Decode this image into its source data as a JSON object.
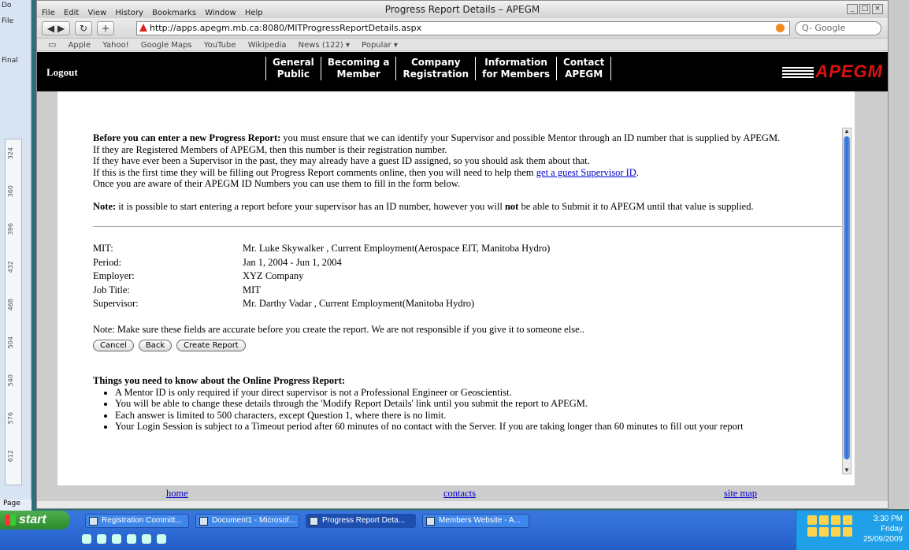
{
  "word": {
    "toolbar_items": [
      "Do",
      "File",
      "Final",
      "Page"
    ],
    "ruler_marks": [
      "324",
      "360",
      "396",
      "432",
      "468",
      "504",
      "540",
      "576",
      "612"
    ]
  },
  "browser": {
    "title": "Progress Report Details – APEGM",
    "menu": [
      "File",
      "Edit",
      "View",
      "History",
      "Bookmarks",
      "Window",
      "Help"
    ],
    "url": "http://apps.apegm.mb.ca:8080/MITProgressReportDetails.aspx",
    "search_placeholder": "Q- Google",
    "bookmarks": [
      "Apple",
      "Yahoo!",
      "Google Maps",
      "YouTube",
      "Wikipedia",
      "News (122) ▾",
      "Popular ▾"
    ]
  },
  "site": {
    "logout": "Logout",
    "nav": [
      {
        "line1": "General",
        "line2": "Public"
      },
      {
        "line1": "Becoming a",
        "line2": "Member"
      },
      {
        "line1": "Company",
        "line2": "Registration"
      },
      {
        "line1": "Information",
        "line2": "for Members"
      },
      {
        "line1": "Contact",
        "line2": "APEGM"
      }
    ],
    "logo": "APEGM"
  },
  "intro": {
    "lead_bold": "Before you can enter a new Progress Report:",
    "lead_rest": " you must ensure that we can identify your Supervisor and possible Mentor through an ID number that is supplied by APEGM.",
    "line2": "If they are Registered Members of APEGM, then this number is their registration number.",
    "line3": "If they have ever been a Supervisor in the past, they may already have a guest ID assigned, so you should ask them about that.",
    "line4_pre": "If this is the first time they will be filling out Progress Report comments online, then you will need to help them ",
    "line4_link": "get a guest Supervisor ID",
    "line4_post": ".",
    "line5": "Once you are aware of their APEGM ID Numbers you can use them to fill in the form below.",
    "note_bold": "Note:",
    "note_a": " it is possible to start entering a report before your supervisor has an ID number, however you will ",
    "note_not": "not",
    "note_b": " be able to Submit it to APEGM until that value is supplied."
  },
  "details": [
    {
      "label": "MIT:",
      "value": "Mr. Luke Skywalker , Current Employment(Aerospace EIT, Manitoba Hydro)"
    },
    {
      "label": "Period:",
      "value": "Jan 1, 2004 - Jun 1, 2004"
    },
    {
      "label": "Employer:",
      "value": "XYZ Company"
    },
    {
      "label": "Job Title:",
      "value": "MIT"
    },
    {
      "label": "Supervisor:",
      "value": "Mr. Darthy Vadar , Current Employment(Manitoba Hydro)"
    }
  ],
  "fields_note": "Note: Make sure these fields are accurate before you create the report. We are not responsible if you give it to someone else..",
  "buttons": {
    "cancel": "Cancel",
    "back": "Back",
    "create": "Create Report"
  },
  "know": {
    "heading": "Things you need to know about the Online Progress Report:",
    "items": [
      "A Mentor ID is only required if your direct supervisor is not a Professional Engineer or Geoscientist.",
      "You will be able to change these details through the 'Modify Report Details' link until you submit the report to APEGM.",
      "Each answer is limited to 500 characters, except Question 1, where there is no limit.",
      "Your Login Session is subject to a Timeout period after 60 minutes of no contact with the Server. If you are taking longer than 60 minutes to fill out your report"
    ]
  },
  "footer": {
    "home": "home",
    "contacts": "contacts",
    "sitemap": "site map"
  },
  "taskbar": {
    "start": "start",
    "tasks": [
      "Registration Committ...",
      "Document1 - Microsof...",
      "Progress Report Deta...",
      "Members Website - A..."
    ],
    "time": "3:30 PM",
    "day": "Friday",
    "date": "25/09/2009"
  }
}
